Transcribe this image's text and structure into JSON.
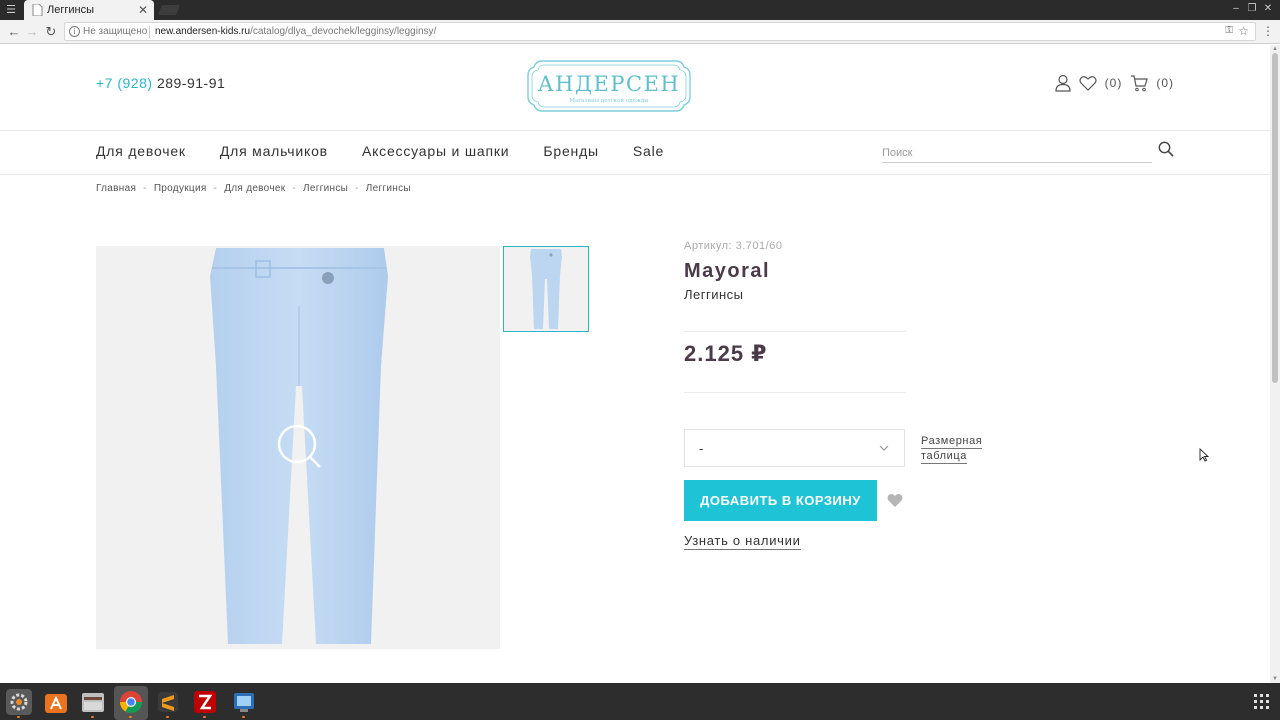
{
  "browser": {
    "tab_title": "Леггинсы",
    "tab_close": "✕",
    "security_label": "Не защищено",
    "url_host": "new.andersen-kids.ru",
    "url_path": "/catalog/dlya_devochek/legginsy/legginsy/"
  },
  "header": {
    "phone_code": "+7 (928)",
    "phone_number": "289-91-91",
    "logo_text": "АНДЕРСЕН",
    "logo_tagline": "Магазины детской одежды",
    "wishlist_count": "(0)",
    "cart_count": "(0)"
  },
  "nav": {
    "items": [
      "Для девочек",
      "Для мальчиков",
      "Аксессуары и шапки",
      "Бренды",
      "Sale"
    ],
    "search_placeholder": "Поиск"
  },
  "breadcrumbs": [
    "Главная",
    "Продукция",
    "Для девочек",
    "Леггинсы",
    "Леггинсы"
  ],
  "product": {
    "sku": "Артикул: 3.701/60",
    "brand": "Mayoral",
    "type": "Леггинсы",
    "price": "2.125 ₽",
    "size_value": "-",
    "size_table_line1": "Размерная",
    "size_table_line2": "таблица",
    "add_to_cart": "ДОБАВИТЬ В КОРЗИНУ",
    "availability": "Узнать о наличии"
  },
  "colors": {
    "accent": "#1ec4d6",
    "teal_text": "#2bb6c8",
    "brand_text": "#4a3a4a"
  },
  "taskbar": {
    "apps": [
      "settings-icon",
      "software-center-icon",
      "files-icon",
      "chrome-icon",
      "sublime-icon",
      "filezilla-icon",
      "screenshot-icon"
    ]
  }
}
